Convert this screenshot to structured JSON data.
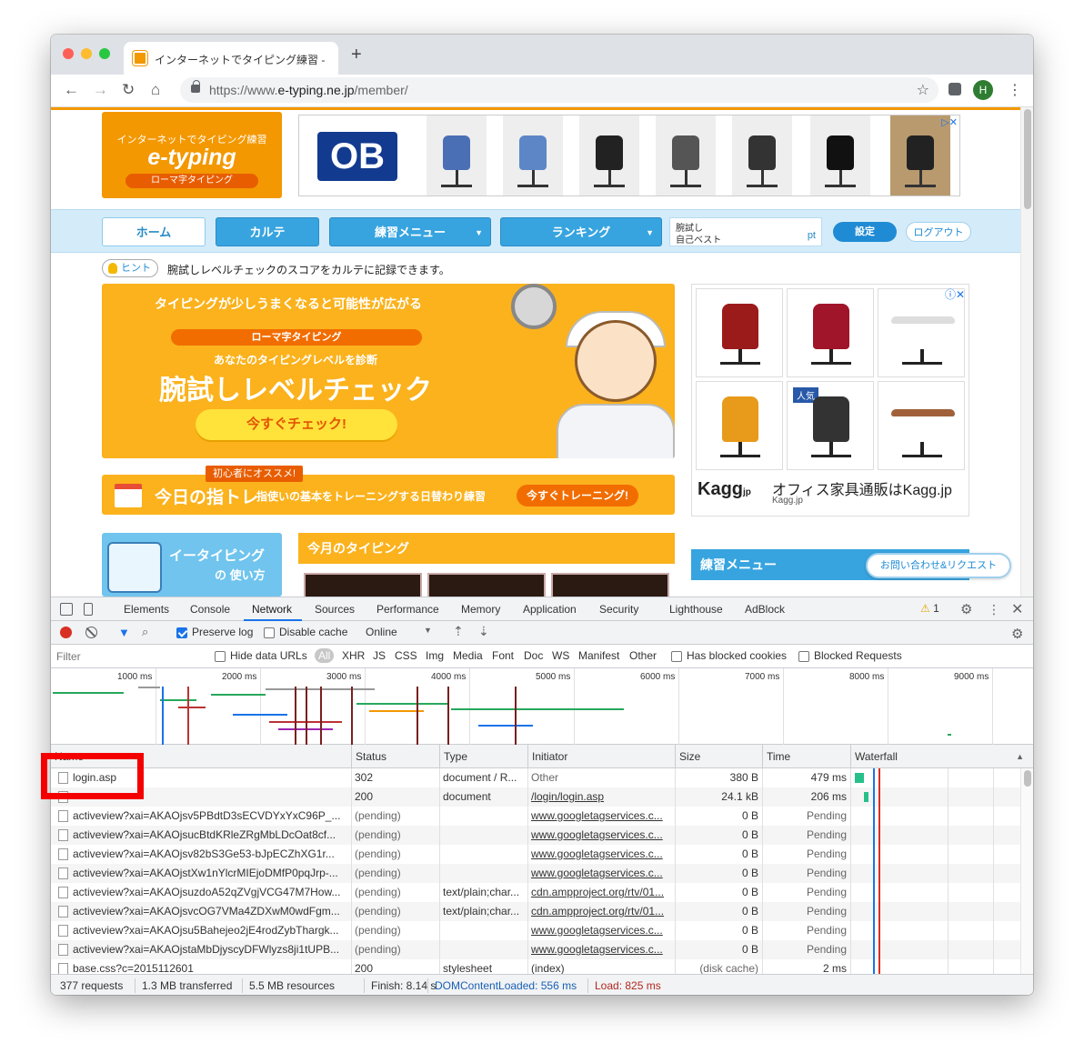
{
  "browser": {
    "tab_title": "インターネットでタイピング練習 -",
    "url_prefix": "https://www.",
    "url_host": "e-typing.ne.jp",
    "url_path": "/member/",
    "avatar_initial": "H",
    "new_tab": "+"
  },
  "site": {
    "logo_sub": "インターネットでタイピング練習",
    "logo_main": "e-typing",
    "logo_pill": "ローマ字タイピング",
    "ad_brand": "OB",
    "nav": {
      "home": "ホーム",
      "karte": "カルテ",
      "practice_menu": "練習メニュー",
      "ranking": "ランキング",
      "score_line1": "腕試し",
      "score_line2": "自己ベスト",
      "score_unit": "pt",
      "settings": "設定",
      "logout": "ログアウト"
    },
    "hint_label": "ヒント",
    "hint_text": "腕試しレベルチェックのスコアをカルテに記録できます。",
    "hero": {
      "tagline": "タイピングが少しうまくなると可能性が広がる",
      "pill": "ローマ字タイピング",
      "sub": "あなたのタイピングレベルを診断",
      "main": "腕試しレベルチェック",
      "cta": "今すぐチェック!"
    },
    "training": {
      "badge": "初心者にオススメ!",
      "title": "今日の指トレ",
      "desc": "指使いの基本をトレーニングする日替わり練習",
      "button": "今すぐトレーニング!"
    },
    "howto": {
      "title": "イータイピング",
      "sub": "の 使い方"
    },
    "month_head": "今月のタイピング",
    "side_ad": {
      "badge": "人気",
      "brand": "Kagg",
      "brand_suffix": "jp",
      "text": "オフィス家具通販はKagg.jp",
      "sub": "Kagg.jp"
    },
    "practice_head": "練習メニュー",
    "contact": "お問い合わせ&リクエスト"
  },
  "devtools": {
    "tabs": [
      "Elements",
      "Console",
      "Network",
      "Sources",
      "Performance",
      "Memory",
      "Application",
      "Security",
      "Lighthouse",
      "AdBlock"
    ],
    "active_tab": "Network",
    "warning_count": "1",
    "preserve_log": "Preserve log",
    "disable_cache": "Disable cache",
    "throttling": "Online",
    "filter_placeholder": "Filter",
    "hide_data_urls": "Hide data URLs",
    "resource_types": [
      "All",
      "XHR",
      "JS",
      "CSS",
      "Img",
      "Media",
      "Font",
      "Doc",
      "WS",
      "Manifest",
      "Other"
    ],
    "has_blocked_cookies": "Has blocked cookies",
    "blocked_requests": "Blocked Requests",
    "timeline_ticks": [
      "1000 ms",
      "2000 ms",
      "3000 ms",
      "4000 ms",
      "5000 ms",
      "6000 ms",
      "7000 ms",
      "8000 ms",
      "9000 ms"
    ],
    "columns": {
      "name": "Name",
      "status": "Status",
      "type": "Type",
      "initiator": "Initiator",
      "size": "Size",
      "time": "Time",
      "waterfall": "Waterfall"
    },
    "rows": [
      {
        "name": "login.asp",
        "status": "302",
        "type": "document / R...",
        "initiator": "Other",
        "size": "380 B",
        "time": "479 ms"
      },
      {
        "name": "",
        "status": "200",
        "type": "document",
        "initiator": "/login/login.asp",
        "size": "24.1 kB",
        "time": "206 ms"
      },
      {
        "name": "activeview?xai=AKAOjsv5PBdtD3sECVDYxYxC96P_...",
        "status": "(pending)",
        "type": "",
        "initiator": "www.googletagservices.c...",
        "size": "0 B",
        "time": "Pending"
      },
      {
        "name": "activeview?xai=AKAOjsucBtdKRleZRgMbLDcOat8cf...",
        "status": "(pending)",
        "type": "",
        "initiator": "www.googletagservices.c...",
        "size": "0 B",
        "time": "Pending"
      },
      {
        "name": "activeview?xai=AKAOjsv82bS3Ge53-bJpECZhXG1r...",
        "status": "(pending)",
        "type": "",
        "initiator": "www.googletagservices.c...",
        "size": "0 B",
        "time": "Pending"
      },
      {
        "name": "activeview?xai=AKAOjstXw1nYlcrMIEjoDMfP0pqJrp-...",
        "status": "(pending)",
        "type": "",
        "initiator": "www.googletagservices.c...",
        "size": "0 B",
        "time": "Pending"
      },
      {
        "name": "activeview?xai=AKAOjsuzdoA52qZVgjVCG47M7How...",
        "status": "(pending)",
        "type": "text/plain;char...",
        "initiator": "cdn.ampproject.org/rtv/01...",
        "size": "0 B",
        "time": "Pending"
      },
      {
        "name": "activeview?xai=AKAOjsvcOG7VMa4ZDXwM0wdFgm...",
        "status": "(pending)",
        "type": "text/plain;char...",
        "initiator": "cdn.ampproject.org/rtv/01...",
        "size": "0 B",
        "time": "Pending"
      },
      {
        "name": "activeview?xai=AKAOjsu5Bahejeo2jE4rodZybThargk...",
        "status": "(pending)",
        "type": "",
        "initiator": "www.googletagservices.c...",
        "size": "0 B",
        "time": "Pending"
      },
      {
        "name": "activeview?xai=AKAOjstaMbDjyscyDFWlyzs8ji1tUPB...",
        "status": "(pending)",
        "type": "",
        "initiator": "www.googletagservices.c...",
        "size": "0 B",
        "time": "Pending"
      },
      {
        "name": "base.css?c=2015112601",
        "status": "200",
        "type": "stylesheet",
        "initiator": "(index)",
        "size": "(disk cache)",
        "time": "2 ms"
      }
    ],
    "status_bar": {
      "requests": "377 requests",
      "transferred": "1.3 MB transferred",
      "resources": "5.5 MB resources",
      "finish": "Finish: 8.14 s",
      "dom_content_loaded": "DOMContentLoaded: 556 ms",
      "load": "Load: 825 ms"
    }
  },
  "colors": {
    "brand_orange": "#f39800",
    "nav_blue": "#37a4e0",
    "devtools_accent": "#1a73e8",
    "annotation_red": "#f40000"
  }
}
